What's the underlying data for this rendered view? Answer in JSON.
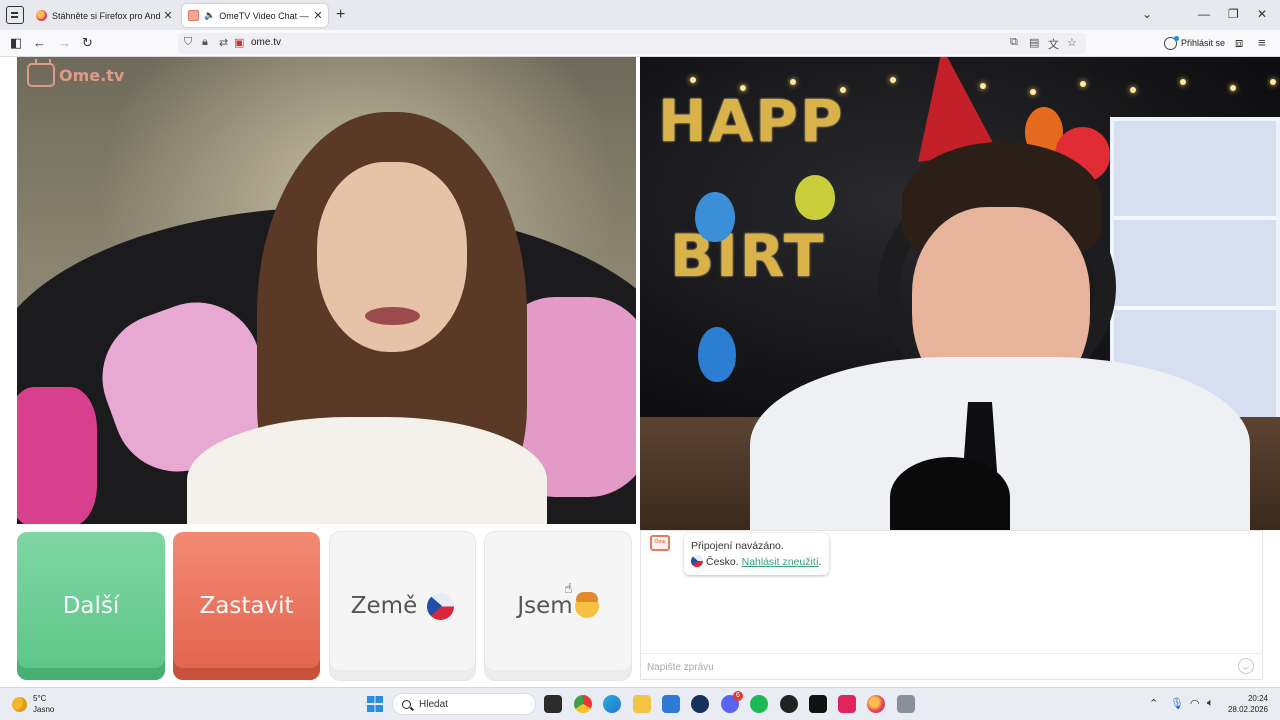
{
  "browser": {
    "tabs": [
      {
        "title": "Stáhněte si Firefox pro Android",
        "favicon": "firefox-icon",
        "active": false
      },
      {
        "title": "OmeTV Video Chat — Ome",
        "favicon": "ometv-icon",
        "active": true,
        "playing_audio": true
      }
    ],
    "url": "ome.tv",
    "sign_in_label": "Přihlásit se"
  },
  "page": {
    "logo_text": "Ome.tv",
    "buttons": {
      "next_label": "Další",
      "stop_label": "Zastavit",
      "country_label": "Země",
      "gender_label": "Jsem"
    },
    "chat": {
      "message_line1": "Připojení navázáno.",
      "country_text": "Česko.",
      "report_link": "Nahlásit zneužití",
      "report_suffix": ".",
      "input_placeholder": "Napište zprávu"
    },
    "remote_video_decor_text": "HAPPY BIRTHDAY",
    "colors": {
      "next_green": "#5cc587",
      "stop_red": "#e3624d",
      "link_green": "#3aa079"
    }
  },
  "taskbar": {
    "weather_temp": "5°C",
    "weather_desc": "Jasno",
    "search_placeholder": "Hledat",
    "time": "20:24",
    "date": "28.02.2026",
    "notification_badge": "6"
  }
}
